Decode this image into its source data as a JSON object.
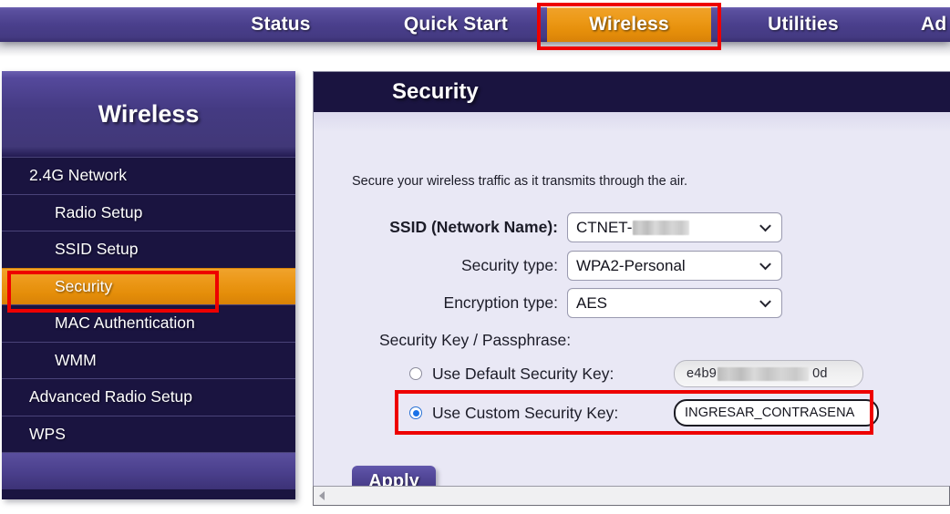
{
  "topnav": {
    "tabs": [
      {
        "label": "Status",
        "active": false
      },
      {
        "label": "Quick Start",
        "active": false
      },
      {
        "label": "Wireless",
        "active": true
      },
      {
        "label": "Utilities",
        "active": false
      },
      {
        "label": "Ad",
        "active": false
      }
    ]
  },
  "sidebar": {
    "header": "Wireless",
    "items": [
      {
        "label": "2.4G Network",
        "level": 1,
        "active": false
      },
      {
        "label": "Radio Setup",
        "level": 2,
        "active": false
      },
      {
        "label": "SSID Setup",
        "level": 2,
        "active": false
      },
      {
        "label": "Security",
        "level": 2,
        "active": true
      },
      {
        "label": "MAC Authentication",
        "level": 2,
        "active": false
      },
      {
        "label": "WMM",
        "level": 2,
        "active": false
      },
      {
        "label": "Advanced Radio Setup",
        "level": 1,
        "active": false
      },
      {
        "label": "WPS",
        "level": 1,
        "active": false
      }
    ]
  },
  "main": {
    "title": "Security",
    "intro": "Secure your wireless traffic as it transmits through the air.",
    "fields": {
      "ssid_label": "SSID (Network Name):",
      "ssid_value": "CTNET-",
      "ssid_redacted": true,
      "security_type_label": "Security type:",
      "security_type_value": "WPA2-Personal",
      "encryption_type_label": "Encryption type:",
      "encryption_type_value": "AES"
    },
    "security_key": {
      "section_label": "Security Key / Passphrase:",
      "default_option_label": "Use Default Security Key:",
      "default_option_selected": false,
      "default_key_prefix": "e4b9",
      "default_key_suffix": "0d",
      "custom_option_label": "Use Custom Security Key:",
      "custom_option_selected": true,
      "custom_key_value": "INGRESAR_CONTRASENA"
    },
    "apply_label": "Apply"
  },
  "colors": {
    "nav_purple": "#4a3f8c",
    "accent_orange": "#ec9818",
    "dark_navy": "#1a1440",
    "content_bg": "#e9e8f5",
    "highlight_red": "#ee0000",
    "radio_blue": "#1a73e8"
  }
}
